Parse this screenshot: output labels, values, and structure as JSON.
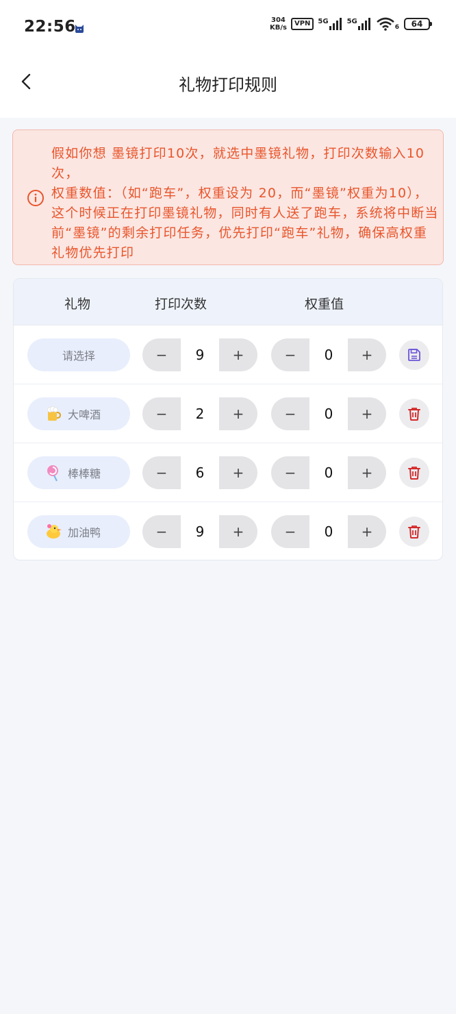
{
  "status_bar": {
    "time": "22:56",
    "speed_value": "304",
    "speed_unit": "KB/s",
    "vpn": "VPN",
    "sim1": "5G",
    "sim2": "5G",
    "wifi_sub": "6",
    "battery": "64"
  },
  "header": {
    "title": "礼物打印规则"
  },
  "notice": {
    "line1": "假如你想 墨镜打印10次，就选中墨镜礼物，打印次数输入10次，",
    "line2": "权重数值：（如“跑车”，权重设为 20，而“墨镜”权重为10），这个时候正在打印墨镜礼物，同时有人送了跑车，系统将中断当前“墨镜”的剩余打印任务，优先打印“跑车”礼物，确保高权重礼物优先打印",
    "accent_color": "#e8552b"
  },
  "table": {
    "headers": {
      "gift": "礼物",
      "count": "打印次数",
      "weight": "权重值"
    },
    "stepper": {
      "minus": "−",
      "plus": "+"
    },
    "rows": [
      {
        "gift": "请选择",
        "icon": "none",
        "count": "9",
        "weight": "0",
        "action": "save-icon"
      },
      {
        "gift": "大啤酒",
        "icon": "beer-icon",
        "count": "2",
        "weight": "0",
        "action": "trash-icon"
      },
      {
        "gift": "棒棒糖",
        "icon": "lollipop-icon",
        "count": "6",
        "weight": "0",
        "action": "trash-icon"
      },
      {
        "gift": "加油鸭",
        "icon": "duck-icon",
        "count": "9",
        "weight": "0",
        "action": "trash-icon"
      }
    ]
  }
}
